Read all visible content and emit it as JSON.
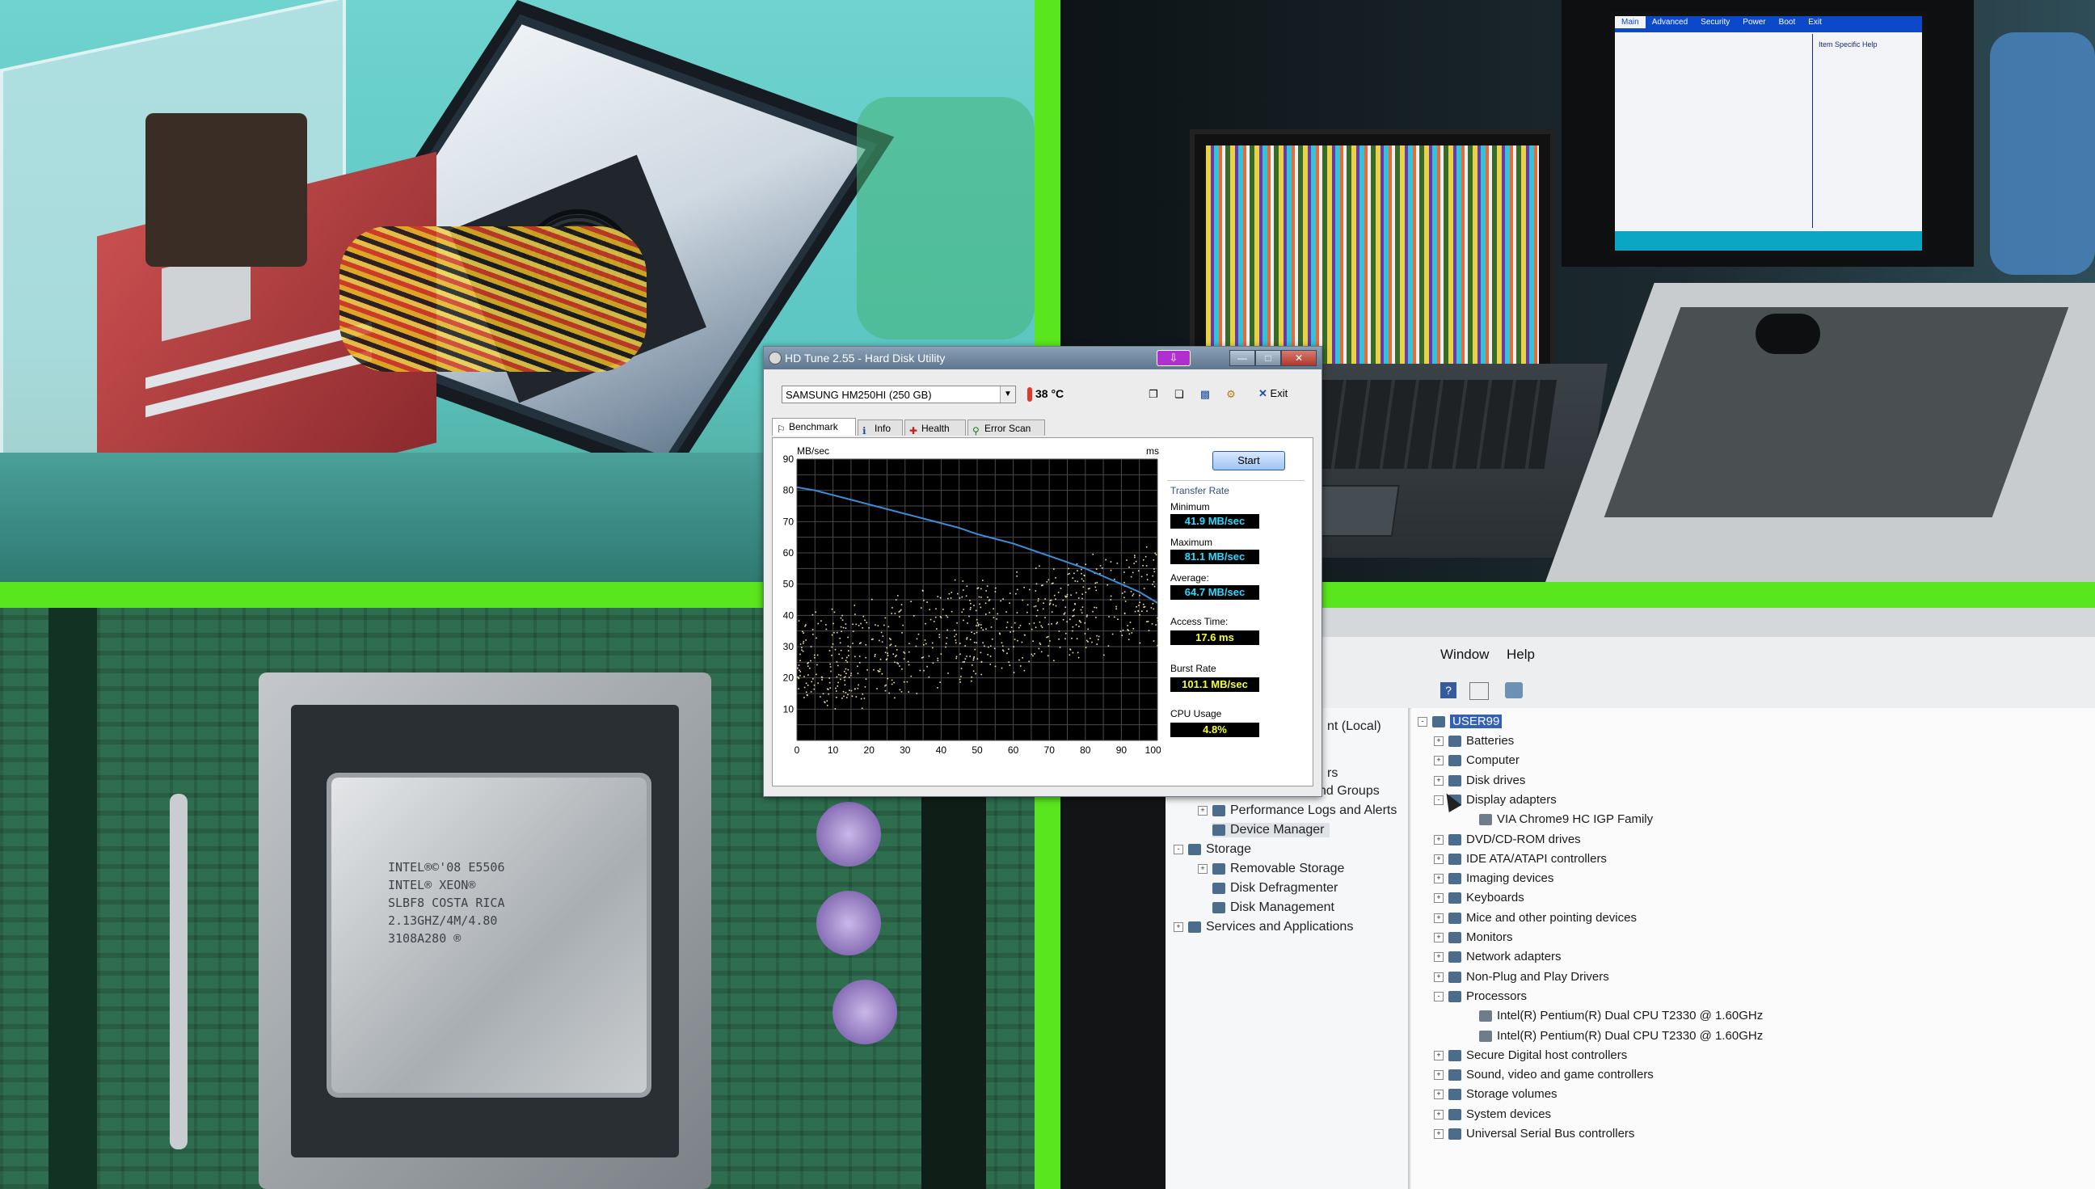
{
  "hdtune": {
    "title": "HD Tune 2.55 - Hard Disk Utility",
    "drive": "SAMSUNG HM250HI (250 GB)",
    "temperature": "38 °C",
    "exit_label": "Exit",
    "tabs": [
      {
        "label": "Benchmark",
        "icon": "benchmark-icon"
      },
      {
        "label": "Info",
        "icon": "info-icon"
      },
      {
        "label": "Health",
        "icon": "health-icon"
      },
      {
        "label": "Error Scan",
        "icon": "error-scan-icon"
      }
    ],
    "start_label": "Start",
    "transfer_rate_label": "Transfer Rate",
    "minimum_label": "Minimum",
    "minimum_value": "41.9 MB/sec",
    "maximum_label": "Maximum",
    "maximum_value": "81.1 MB/sec",
    "average_label": "Average:",
    "average_value": "64.7 MB/sec",
    "access_time_label": "Access Time:",
    "access_time_value": "17.6 ms",
    "burst_rate_label": "Burst Rate",
    "burst_rate_value": "101.1 MB/sec",
    "cpu_usage_label": "CPU Usage",
    "cpu_usage_value": "4.8%"
  },
  "chart_data": {
    "type": "line",
    "ylabel_left": "MB/sec",
    "ylabel_right": "ms",
    "ylim_left": [
      0,
      90
    ],
    "ylim_right": [
      0,
      45
    ],
    "xlim": [
      0,
      100
    ],
    "x_ticks": [
      "0",
      "10",
      "20",
      "30",
      "40",
      "50",
      "60",
      "70",
      "80",
      "90",
      "100%"
    ],
    "y_ticks_left": [
      "10",
      "20",
      "30",
      "40",
      "50",
      "60",
      "70",
      "80",
      "90"
    ],
    "y_ticks_right": [
      "5",
      "10",
      "15",
      "20",
      "25",
      "30",
      "35",
      "40",
      "45"
    ],
    "grid": true,
    "series": [
      {
        "x": [
          0,
          5,
          10,
          15,
          20,
          25,
          30,
          35,
          40,
          45,
          50,
          55,
          60,
          65,
          70,
          75,
          80,
          85,
          90,
          95,
          100
        ],
        "values": [
          81,
          80,
          78.5,
          77,
          75.5,
          74,
          72.5,
          71,
          69.5,
          68,
          66,
          64.5,
          63,
          61,
          59,
          57,
          55,
          52.5,
          50,
          47.5,
          44
        ]
      }
    ],
    "access_scatter": {
      "color": "#f2e6a0",
      "count_hint": "scatter"
    }
  },
  "device_manager": {
    "menu": [
      "Window",
      "Help"
    ],
    "left_pane": [
      "nt (Local)",
      "rs",
      "nd Groups",
      "Performance Logs and Alerts",
      "Device Manager",
      "Storage",
      "Removable Storage",
      "Disk Defragmenter",
      "Disk Management",
      "Services and Applications"
    ],
    "root": "USER99",
    "tree": [
      {
        "label": "Batteries",
        "exp": "+"
      },
      {
        "label": "Computer",
        "exp": "+"
      },
      {
        "label": "Disk drives",
        "exp": "+"
      },
      {
        "label": "Display adapters",
        "exp": "-"
      },
      {
        "label": "VIA Chrome9 HC IGP Family",
        "exp": "",
        "child": true
      },
      {
        "label": "DVD/CD-ROM drives",
        "exp": "+"
      },
      {
        "label": "IDE ATA/ATAPI controllers",
        "exp": "+"
      },
      {
        "label": "Imaging devices",
        "exp": "+"
      },
      {
        "label": "Keyboards",
        "exp": "+"
      },
      {
        "label": "Mice and other pointing devices",
        "exp": "+"
      },
      {
        "label": "Monitors",
        "exp": "+"
      },
      {
        "label": "Network adapters",
        "exp": "+"
      },
      {
        "label": "Non-Plug and Play Drivers",
        "exp": "+"
      },
      {
        "label": "Processors",
        "exp": "-"
      },
      {
        "label": "Intel(R) Pentium(R) Dual  CPU  T2330  @ 1.60GHz",
        "exp": "",
        "child": true
      },
      {
        "label": "Intel(R) Pentium(R) Dual  CPU  T2330  @ 1.60GHz",
        "exp": "",
        "child": true
      },
      {
        "label": "Secure Digital host controllers",
        "exp": "+"
      },
      {
        "label": "Sound, video and game controllers",
        "exp": "+"
      },
      {
        "label": "Storage volumes",
        "exp": "+"
      },
      {
        "label": "System devices",
        "exp": "+"
      },
      {
        "label": "Universal Serial Bus controllers",
        "exp": "+"
      }
    ]
  },
  "cpu_chip": {
    "lines": [
      "INTEL®©'08 E5506",
      "INTEL® XEON®",
      "SLBF8 COSTA RICA",
      "2.13GHZ/4M/4.80",
      "3108A280 ®"
    ]
  },
  "bios": {
    "tabs": [
      "Main",
      "Advanced",
      "Security",
      "Power",
      "Boot",
      "Exit"
    ],
    "item_help": "Item Specific Help"
  },
  "colors": {
    "separator": "#5ae61e",
    "title_bar": "#6d86a0",
    "value_yellow": "#f4ff2e",
    "value_cyan": "#30d8ff",
    "graph_line": "#3a8fd9"
  }
}
